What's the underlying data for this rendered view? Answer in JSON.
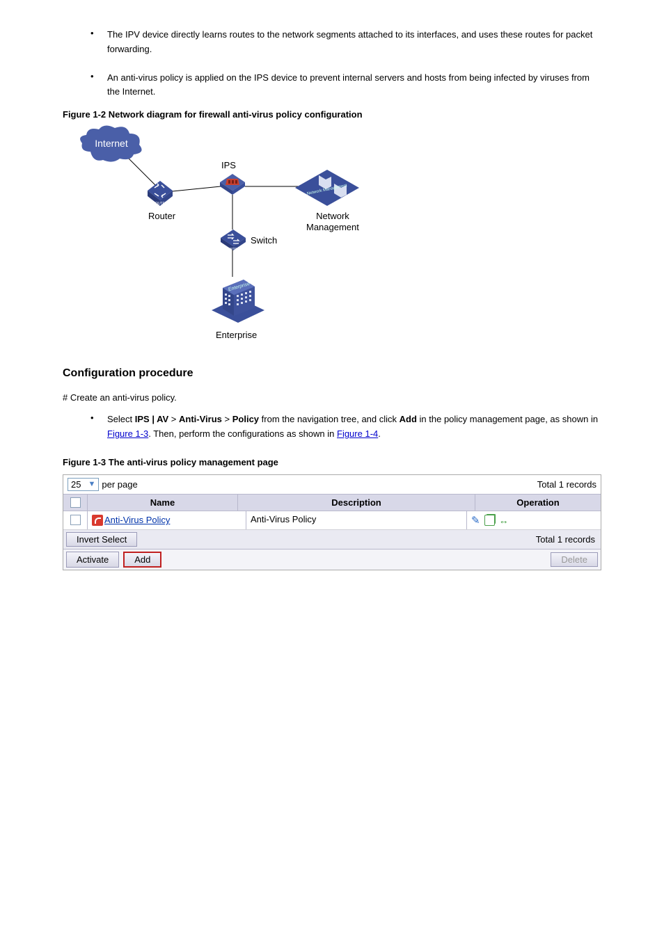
{
  "bullets": {
    "b1": "The IPV device directly learns routes to the network segments attached to its interfaces, and uses these routes for packet forwarding.",
    "b2": "An anti-virus policy is applied on the IPS device to prevent internal servers and hosts from being infected by viruses from the Internet."
  },
  "figure1": {
    "caption": "Figure 1-2 Network diagram for firewall anti-virus policy configuration",
    "labels": {
      "internet": "Internet",
      "ips": "IPS",
      "router": "Router",
      "network_mgmt_l1": "Network",
      "network_mgmt_l2": "Management",
      "switch": "Switch",
      "enterprise": "Enterprise"
    }
  },
  "proc_head": "Configuration procedure",
  "step_lead": "# Create an anti-virus policy.",
  "step_bullet1a": "Select ",
  "step_bullet1b": "IPS | AV",
  "step_bullet1c": " > ",
  "step_bullet1d": "Anti-Virus",
  "step_bullet1e": " > ",
  "step_bullet1f": "Policy",
  "step_bullet1g": " from the navigation tree, and click ",
  "step_bullet1h": "Add",
  "step_bullet1i": " in the policy management page, as shown in ",
  "step_link1": "Figure 1-3",
  "step_after1": ". Then, perform the configurations as shown in ",
  "step_link2": "Figure 1-4",
  "step_after2": ".",
  "figure2_caption": "Figure 1-3 The anti-virus policy management page",
  "ui": {
    "per_page_value": "25",
    "per_page_label": "per page",
    "total_records": "Total 1 records",
    "headers": {
      "name": "Name",
      "description": "Description",
      "operation": "Operation"
    },
    "row": {
      "name": "Anti-Virus Policy",
      "description": "Anti-Virus Policy"
    },
    "invert": "Invert Select",
    "activate": "Activate",
    "add": "Add",
    "delete": "Delete"
  }
}
